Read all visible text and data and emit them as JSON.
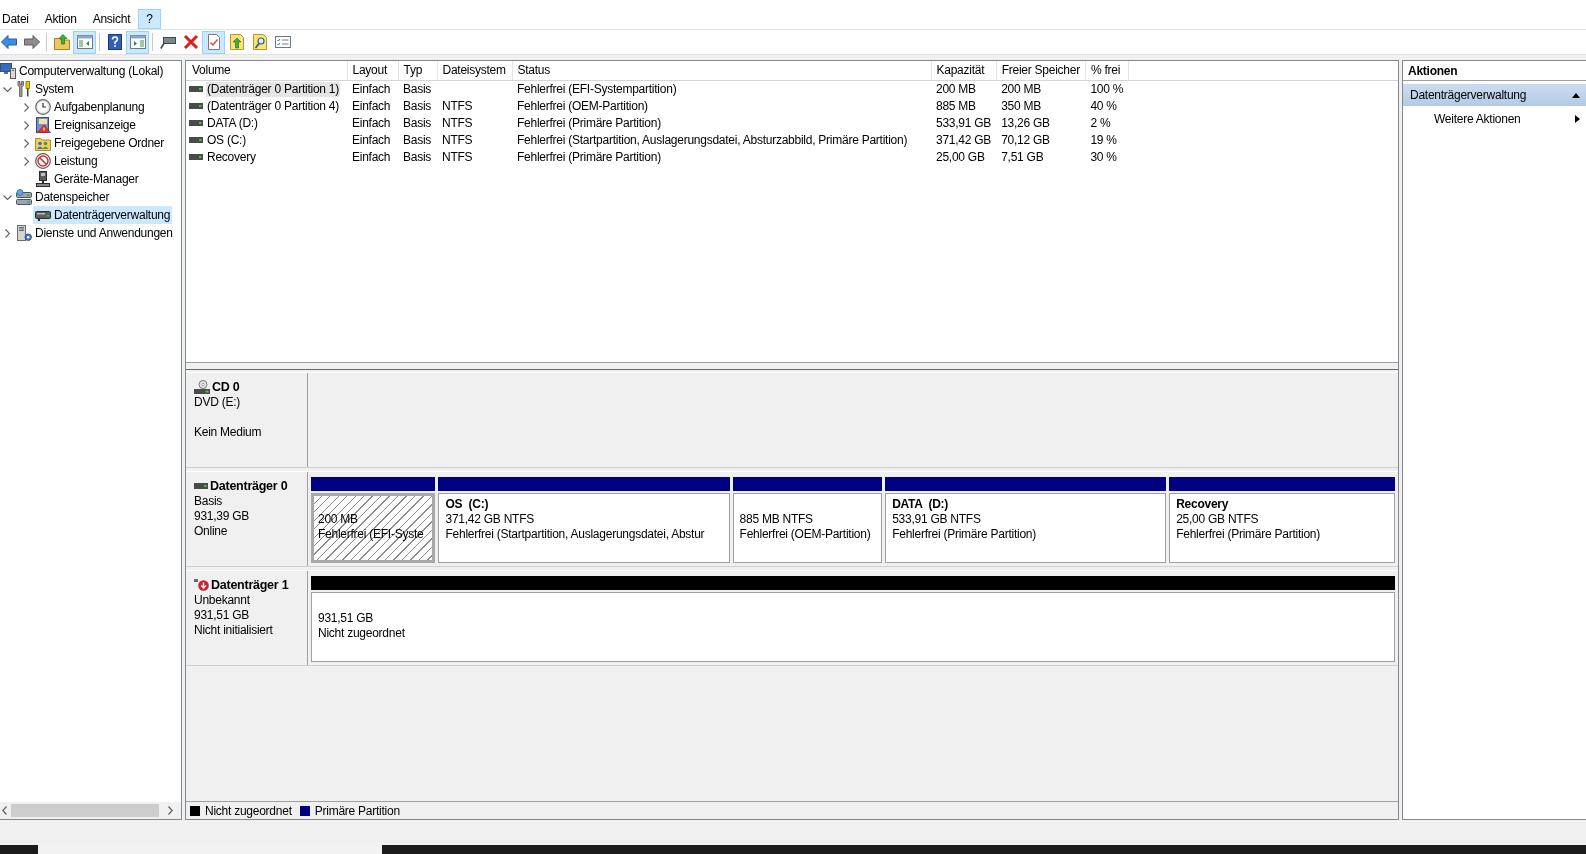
{
  "menu": [
    {
      "label": "Datei",
      "selected": false
    },
    {
      "label": "Aktion",
      "selected": false
    },
    {
      "label": "Ansicht",
      "selected": false
    },
    {
      "label": "?",
      "selected": true
    }
  ],
  "toolbar": [
    {
      "kind": "back",
      "pressed": false
    },
    {
      "kind": "forward",
      "pressed": false
    },
    {
      "kind": "separator"
    },
    {
      "kind": "up",
      "pressed": false
    },
    {
      "kind": "tree",
      "pressed": true
    },
    {
      "kind": "separator"
    },
    {
      "kind": "help",
      "pressed": false
    },
    {
      "kind": "pane",
      "pressed": true
    },
    {
      "kind": "separator"
    },
    {
      "kind": "connect",
      "pressed": false
    },
    {
      "kind": "delete",
      "pressed": false
    },
    {
      "kind": "check",
      "pressed": true
    },
    {
      "kind": "export",
      "pressed": false
    },
    {
      "kind": "find",
      "pressed": false
    },
    {
      "kind": "properties",
      "pressed": false
    }
  ],
  "tree": [
    {
      "label": "Computerverwaltung (Lokal)",
      "kind": "computer",
      "selected": false,
      "children": [
        {
          "label": "System",
          "kind": "tools",
          "expanded": true,
          "selected": false,
          "children": [
            {
              "label": "Aufgabenplanung",
              "kind": "clock",
              "expanded": false,
              "selected": false
            },
            {
              "label": "Ereignisanzeige",
              "kind": "eventlog",
              "expanded": false,
              "selected": false
            },
            {
              "label": "Freigegebene Ordner",
              "kind": "shared",
              "expanded": false,
              "selected": false
            },
            {
              "label": "Leistung",
              "kind": "performance",
              "expanded": false,
              "selected": false
            },
            {
              "label": "Geräte-Manager",
              "kind": "devices",
              "selected": false
            }
          ]
        },
        {
          "label": "Datenspeicher",
          "kind": "storage",
          "expanded": true,
          "selected": false,
          "children": [
            {
              "label": "Datenträgerverwaltung",
              "kind": "diskmgmt",
              "selected": true
            }
          ]
        },
        {
          "label": "Dienste und Anwendungen",
          "kind": "services",
          "expanded": false,
          "selected": false
        }
      ]
    }
  ],
  "volume_table": {
    "columns": [
      "Volume",
      "Layout",
      "Typ",
      "Dateisystem",
      "Status",
      "Kapazität",
      "Freier Speicher",
      "% frei"
    ],
    "rows": [
      {
        "volume": "(Datenträger 0 Partition 1)",
        "layout": "Einfach",
        "type": "Basis",
        "status": "Fehlerfrei (EFI-Systempartition)",
        "capacity": "200 MB",
        "free_space": "200 MB",
        "percent_free": "100 %",
        "selected": true
      },
      {
        "volume": "(Datenträger 0 Partition 4)",
        "layout": "Einfach",
        "type": "Basis",
        "file_system": "NTFS",
        "status": "Fehlerfrei (OEM-Partition)",
        "capacity": "885 MB",
        "free_space": "350 MB",
        "percent_free": "40 %",
        "selected": false
      },
      {
        "volume": "DATA (D:)",
        "layout": "Einfach",
        "type": "Basis",
        "file_system": "NTFS",
        "status": "Fehlerfrei (Primäre Partition)",
        "capacity": "533,91 GB",
        "free_space": "13,26 GB",
        "percent_free": "2 %",
        "selected": false
      },
      {
        "volume": "OS (C:)",
        "layout": "Einfach",
        "type": "Basis",
        "file_system": "NTFS",
        "status": "Fehlerfrei (Startpartition, Auslagerungsdatei, Absturzabbild, Primäre Partition)",
        "capacity": "371,42 GB",
        "free_space": "70,12 GB",
        "percent_free": "19 %",
        "selected": false
      },
      {
        "volume": "Recovery",
        "layout": "Einfach",
        "type": "Basis",
        "file_system": "NTFS",
        "status": "Fehlerfrei (Primäre Partition)",
        "capacity": "25,00 GB",
        "free_space": "7,51 GB",
        "percent_free": "30 %",
        "selected": false
      }
    ]
  },
  "disks": [
    {
      "kind": "cdrom",
      "name": "CD 0",
      "type": "DVD (E:)",
      "status": "Kein Medium"
    },
    {
      "kind": "disk",
      "name": "Datenträger 0",
      "type": "Basis",
      "size": "931,39 GB",
      "status": "Online",
      "partitions": [
        {
          "size": "200 MB",
          "status": "Fehlerfrei (EFI-Syste",
          "color": "#000080",
          "selected": true
        },
        {
          "name": "OS  (C:)",
          "size": "371,42 GB NTFS",
          "status": "Fehlerfrei (Startpartition, Auslagerungsdatei, Abstur",
          "color": "#000080",
          "selected": false
        },
        {
          "size": "885 MB NTFS",
          "status": "Fehlerfrei (OEM-Partition)",
          "color": "#000080",
          "selected": false
        },
        {
          "name": "DATA  (D:)",
          "size": "533,91 GB NTFS",
          "status": "Fehlerfrei (Primäre Partition)",
          "color": "#000080",
          "selected": false
        },
        {
          "name": "Recovery",
          "size": "25,00 GB NTFS",
          "status": "Fehlerfrei (Primäre Partition)",
          "color": "#000080",
          "selected": false
        }
      ]
    },
    {
      "kind": "unknown",
      "name": "Datenträger 1",
      "type": "Unbekannt",
      "size": "931,51 GB",
      "status": "Nicht initialisiert",
      "partitions": [
        {
          "size": "931,51 GB",
          "status": "Nicht zugeordnet",
          "color": "#000000",
          "selected": false
        }
      ]
    }
  ],
  "legend": [
    {
      "label": "Nicht zugeordnet",
      "color": "#000000"
    },
    {
      "label": "Primäre Partition",
      "color": "#000080"
    }
  ],
  "actions": {
    "title": "Aktionen",
    "sections": [
      {
        "label": "Datenträgerverwaltung",
        "expanded": true,
        "items": [
          {
            "label": "Weitere Aktionen"
          }
        ]
      }
    ]
  }
}
